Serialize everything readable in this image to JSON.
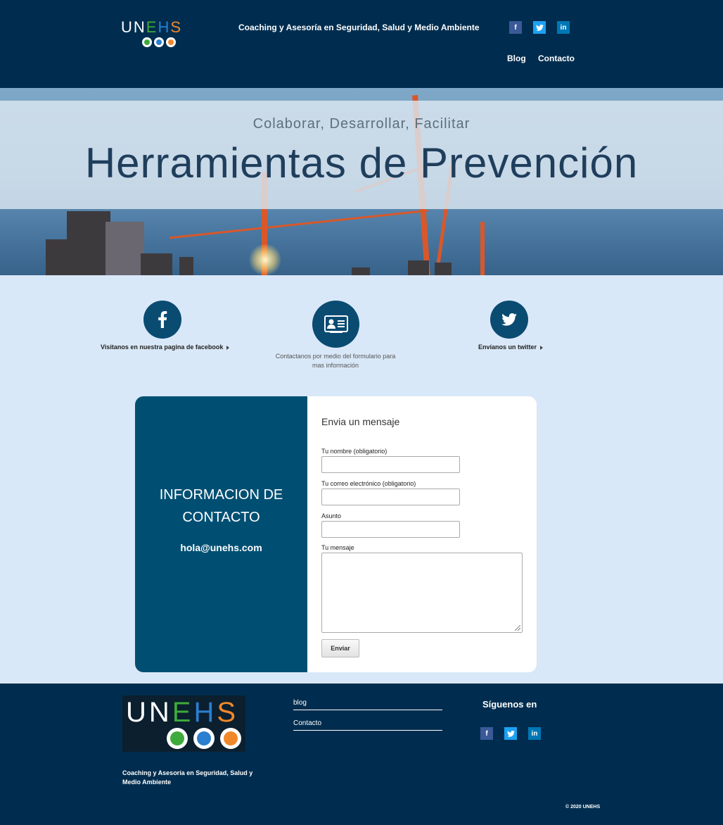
{
  "header": {
    "logo_text": [
      "U",
      "N",
      "E",
      "H",
      "S"
    ],
    "tagline": "Coaching y Asesoría en Seguridad, Salud y Medio Ambiente",
    "social": [
      {
        "name": "facebook",
        "glyph": "f"
      },
      {
        "name": "twitter",
        "glyph": "t"
      },
      {
        "name": "linkedin",
        "glyph": "in"
      }
    ],
    "nav": [
      {
        "label": "Blog"
      },
      {
        "label": "Contacto"
      }
    ]
  },
  "hero": {
    "subtitle": "Colaborar, Desarrollar, Facilitar",
    "title": "Herramientas de Prevención"
  },
  "features": [
    {
      "icon": "facebook-icon",
      "caption": "Visitanos en nuestra pagina de facebook"
    },
    {
      "icon": "contact-card-icon",
      "caption": "Contactanos por medio del formulario para mas información"
    },
    {
      "icon": "twitter-icon",
      "caption": "Envíanos un twitter"
    }
  ],
  "contact": {
    "info_title_line1": "INFORMACION DE",
    "info_title_line2": "CONTACTO",
    "email": "hola@unehs.com",
    "form_title": "Envia un mensaje",
    "fields": [
      {
        "label": "Tu nombre (obligatorio)",
        "value": ""
      },
      {
        "label": "Tu correo electrónico (obligatorio)",
        "value": ""
      },
      {
        "label": "Asunto",
        "value": ""
      },
      {
        "label": "Tu mensaje",
        "value": ""
      }
    ],
    "submit_label": "Enviar"
  },
  "footer": {
    "tagline": "Coaching y Asesoría en Seguridad, Salud y Medio Ambiente",
    "links": [
      {
        "label": "blog"
      },
      {
        "label": "Contacto"
      }
    ],
    "follow_label": "Síguenos en",
    "copyright": "© 2020 UNEHS"
  },
  "colors": {
    "header_bg": "#002d4f",
    "accent_dark_blue": "#004f73",
    "page_bg": "#d9e8f8",
    "logo_green": "#3eaa3b",
    "logo_blue": "#2a7fd0",
    "logo_orange": "#f0882a"
  }
}
